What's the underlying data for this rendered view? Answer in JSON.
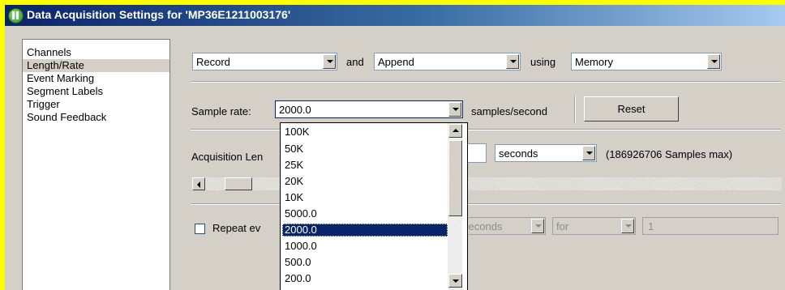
{
  "window": {
    "title": "Data Acquisition Settings for 'MP36E1211003176'"
  },
  "sidebar": {
    "items": [
      {
        "label": "Channels"
      },
      {
        "label": "Length/Rate"
      },
      {
        "label": "Event Marking"
      },
      {
        "label": "Segment Labels"
      },
      {
        "label": "Trigger"
      },
      {
        "label": "Sound Feedback"
      }
    ],
    "selected": "Length/Rate"
  },
  "mode_row": {
    "mode_value": "Record",
    "and_label": "and",
    "append_value": "Append",
    "using_label": "using",
    "storage_value": "Memory"
  },
  "sample_rate": {
    "label": "Sample rate:",
    "value": "2000.0",
    "units": "samples/second",
    "reset_label": "Reset"
  },
  "acquisition_length": {
    "label_visible": "Acquisition Len",
    "units_value": "seconds",
    "max_text": "(186926706 Samples max)"
  },
  "repeat_row": {
    "checkbox_label_visible": "Repeat ev",
    "checked": false,
    "units_value": "seconds",
    "for_value": "for",
    "count_value": "1"
  },
  "rate_dropdown": {
    "options": [
      "100K",
      "50K",
      "25K",
      "20K",
      "10K",
      "5000.0",
      "2000.0",
      "1000.0",
      "500.0",
      "200.0"
    ],
    "selected": "2000.0"
  },
  "colors": {
    "background_outer": "#ffff00",
    "window_bg": "#d4d0c8",
    "title_start": "#0a246a",
    "title_end": "#a6caf0",
    "selection": "#0a246a"
  },
  "icons": {
    "app": "app-logo-icon",
    "combo_arrow": "chevron-down-icon",
    "scroll_left": "arrow-left-icon",
    "scroll_up": "arrow-up-icon",
    "scroll_down": "arrow-down-icon"
  }
}
